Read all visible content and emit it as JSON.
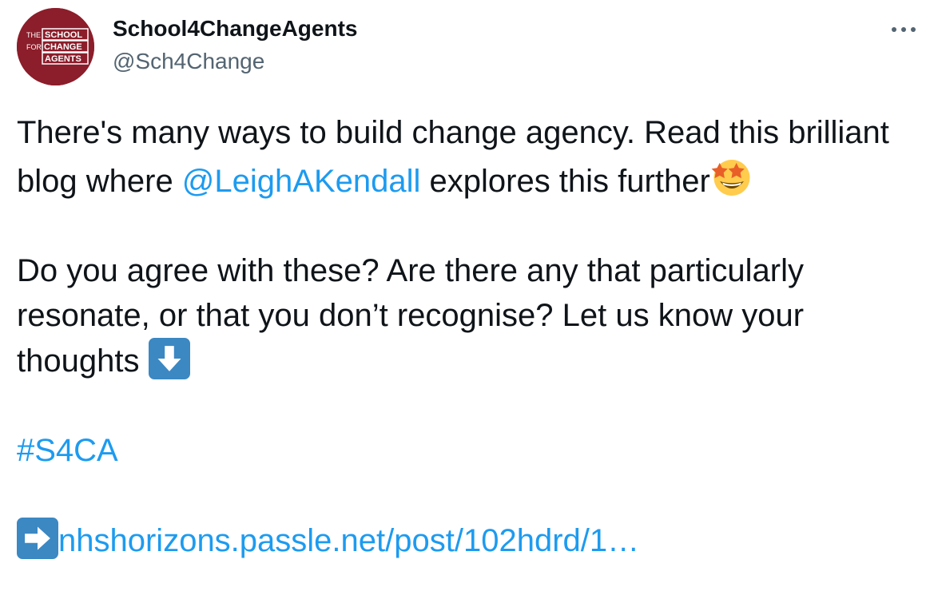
{
  "author": {
    "display_name": "School4ChangeAgents",
    "handle": "@Sch4Change",
    "avatar_logo_text": [
      "THE",
      "SCHOOL",
      "FOR",
      "CHANGE",
      "AGENTS"
    ],
    "avatar_color": "#8c1d2a"
  },
  "more_menu": {
    "icon": "more-horizontal-icon"
  },
  "tweet": {
    "line1_a": "There's many ways to build change agency. Read this brilliant blog where ",
    "mention": "@LeighAKendall",
    "line1_b": " explores this further",
    "emoji_1": "star-struck-emoji",
    "para2": "Do you agree with these? Are there any that particularly resonate, or that you don’t recognise?  Let us know your thoughts ",
    "emoji_2": "down-arrow-emoji",
    "hashtag": "#S4CA",
    "emoji_3": "right-arrow-emoji",
    "url_text": "nhshorizons.passle.net/post/102hdrd/1…"
  },
  "colors": {
    "link": "#1d9bf0",
    "text": "#0f1419",
    "secondary": "#536471",
    "arrow_emoji_bg": "#3b88c3"
  }
}
